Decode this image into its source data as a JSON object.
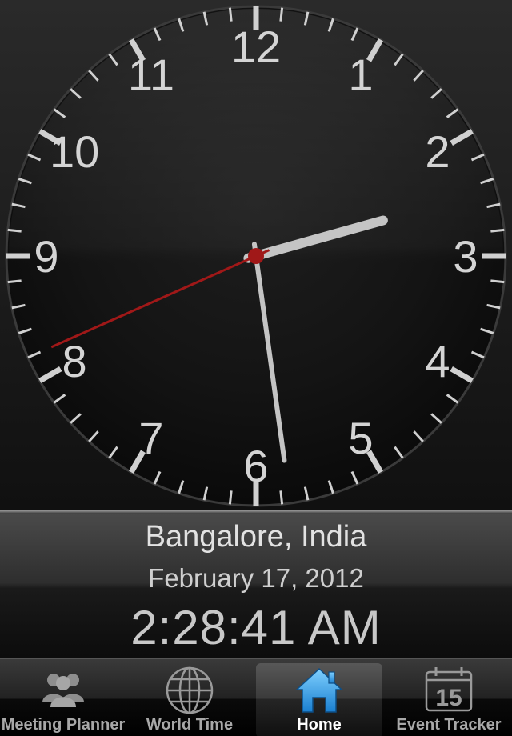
{
  "clock": {
    "numerals": [
      "12",
      "1",
      "2",
      "3",
      "4",
      "5",
      "6",
      "7",
      "8",
      "9",
      "10",
      "11"
    ],
    "hours": 2,
    "minutes": 28,
    "seconds": 41,
    "colors": {
      "face": "#1a1a1a",
      "ticks": "#d0d0d0",
      "hands": "#c4c4c4",
      "second_hand": "#a01818"
    }
  },
  "info": {
    "city": "Bangalore, India",
    "date": "February 17, 2012",
    "time": "2:28:41 AM"
  },
  "tabs": [
    {
      "label": "Meeting Planner",
      "icon": "people-icon",
      "active": false
    },
    {
      "label": "World Time",
      "icon": "globe-icon",
      "active": false
    },
    {
      "label": "Home",
      "icon": "home-icon",
      "active": true
    },
    {
      "label": "Event Tracker",
      "icon": "calendar-icon",
      "active": false,
      "calendar_day": "15"
    }
  ],
  "accent_color": "#2a9fe8"
}
